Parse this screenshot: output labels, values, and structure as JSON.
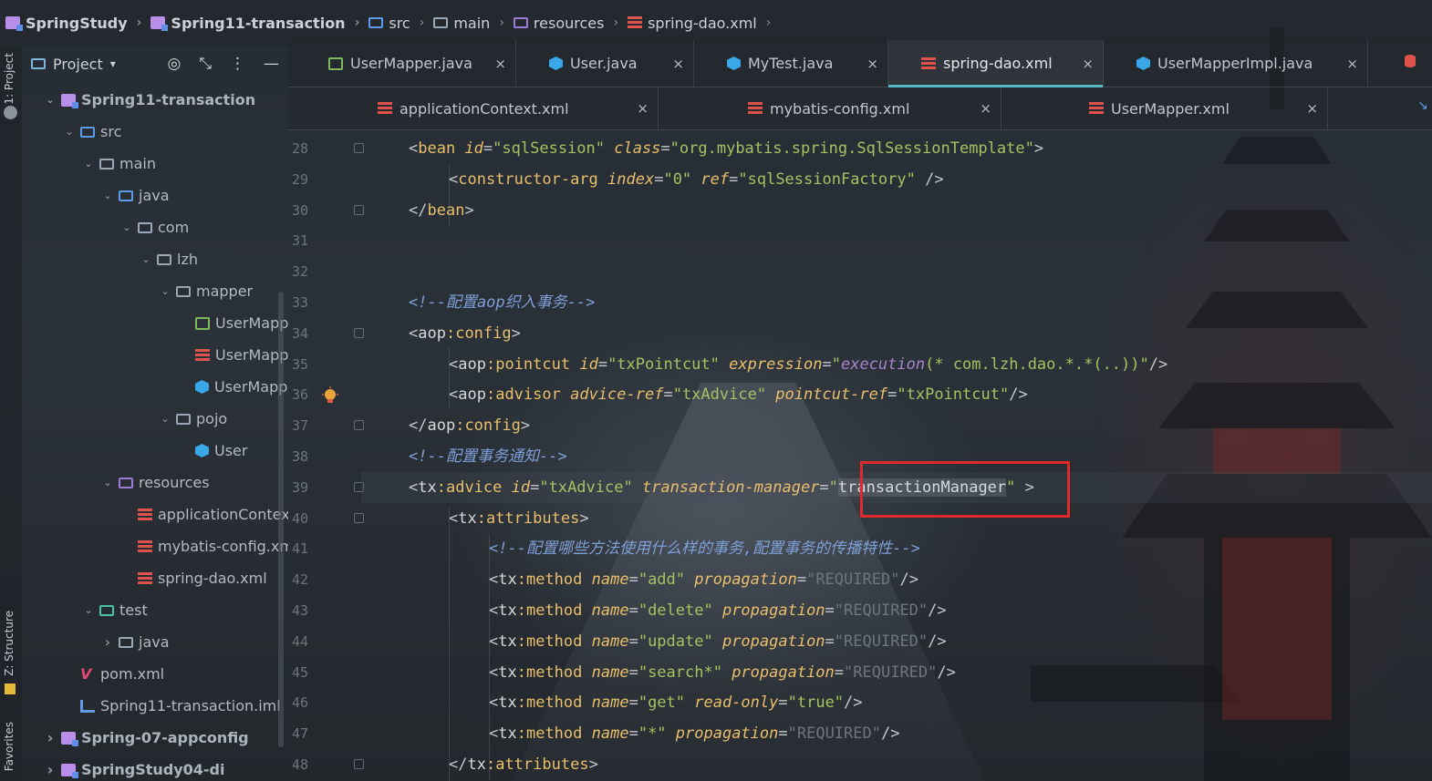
{
  "breadcrumb": [
    {
      "label": "SpringStudy",
      "icon": "module-icon",
      "bold": true
    },
    {
      "label": "Spring11-transaction",
      "icon": "module-icon",
      "bold": true
    },
    {
      "label": "src",
      "icon": "source-folder-icon",
      "bold": false
    },
    {
      "label": "main",
      "icon": "folder-icon",
      "bold": false
    },
    {
      "label": "resources",
      "icon": "resources-folder-icon",
      "bold": false
    },
    {
      "label": "spring-dao.xml",
      "icon": "xml-file-icon",
      "bold": false
    }
  ],
  "side_strip": {
    "project_label": "1: Project",
    "structure_label": "Z: Structure",
    "favorites_label": "Favorites"
  },
  "project_panel": {
    "title": "Project",
    "tree": [
      {
        "label": "Spring11-transaction",
        "depth": 1,
        "arrow": "down",
        "icon": "module",
        "bold": true
      },
      {
        "label": "src",
        "depth": 2,
        "arrow": "down",
        "icon": "src"
      },
      {
        "label": "main",
        "depth": 3,
        "arrow": "down",
        "icon": "folder"
      },
      {
        "label": "java",
        "depth": 4,
        "arrow": "down",
        "icon": "folder-blue"
      },
      {
        "label": "com",
        "depth": 5,
        "arrow": "down",
        "icon": "folder"
      },
      {
        "label": "lzh",
        "depth": 6,
        "arrow": "down",
        "icon": "folder"
      },
      {
        "label": "mapper",
        "depth": 7,
        "arrow": "down",
        "icon": "folder"
      },
      {
        "label": "UserMapp",
        "depth": 8,
        "arrow": "",
        "icon": "iface"
      },
      {
        "label": "UserMapp",
        "depth": 8,
        "arrow": "",
        "icon": "xml"
      },
      {
        "label": "UserMapp",
        "depth": 8,
        "arrow": "",
        "icon": "class"
      },
      {
        "label": "pojo",
        "depth": 7,
        "arrow": "down",
        "icon": "folder"
      },
      {
        "label": "User",
        "depth": 8,
        "arrow": "",
        "icon": "class"
      },
      {
        "label": "resources",
        "depth": 4,
        "arrow": "down",
        "icon": "folder-res"
      },
      {
        "label": "applicationContext",
        "depth": 5,
        "arrow": "",
        "icon": "xml"
      },
      {
        "label": "mybatis-config.xm",
        "depth": 5,
        "arrow": "",
        "icon": "xml"
      },
      {
        "label": "spring-dao.xml",
        "depth": 5,
        "arrow": "",
        "icon": "xml"
      },
      {
        "label": "test",
        "depth": 3,
        "arrow": "down",
        "icon": "folder-test"
      },
      {
        "label": "java",
        "depth": 4,
        "arrow": "right",
        "icon": "folder"
      },
      {
        "label": "pom.xml",
        "depth": 2,
        "arrow": "",
        "icon": "maven"
      },
      {
        "label": "Spring11-transaction.iml",
        "depth": 2,
        "arrow": "",
        "icon": "iml"
      },
      {
        "label": "Spring-07-appconfig",
        "depth": 1,
        "arrow": "right",
        "icon": "module",
        "bold": true
      },
      {
        "label": "SpringStudy04-di",
        "depth": 1,
        "arrow": "right",
        "icon": "module",
        "bold": true
      }
    ]
  },
  "tabs_row1": [
    {
      "label": "UserMapper.java",
      "icon": "iface",
      "active": false
    },
    {
      "label": "User.java",
      "icon": "class",
      "active": false
    },
    {
      "label": "MyTest.java",
      "icon": "class",
      "active": false
    },
    {
      "label": "spring-dao.xml",
      "icon": "xml",
      "active": true
    },
    {
      "label": "UserMapperImpl.java",
      "icon": "class",
      "active": false
    }
  ],
  "tabs_row2": [
    {
      "label": "applicationContext.xml",
      "icon": "xml"
    },
    {
      "label": "mybatis-config.xml",
      "icon": "xml"
    },
    {
      "label": "UserMapper.xml",
      "icon": "xml"
    }
  ],
  "close_glyph": "×",
  "editor": {
    "lines": [
      {
        "n": "28",
        "indent": 0,
        "tokens": [
          [
            "br",
            "<"
          ],
          [
            "tag",
            "bean "
          ],
          [
            "attr",
            "id"
          ],
          [
            "br",
            "="
          ],
          [
            "str",
            "\"sqlSession\" "
          ],
          [
            "attr",
            "class"
          ],
          [
            "br",
            "="
          ],
          [
            "str",
            "\"org.mybatis.spring.SqlSessionTemplate\""
          ],
          [
            "br",
            ">"
          ]
        ]
      },
      {
        "n": "29",
        "indent": 1,
        "tokens": [
          [
            "br",
            "<"
          ],
          [
            "tag",
            "constructor-arg "
          ],
          [
            "attr",
            "index"
          ],
          [
            "br",
            "="
          ],
          [
            "str",
            "\"0\" "
          ],
          [
            "attr",
            "ref"
          ],
          [
            "br",
            "="
          ],
          [
            "str",
            "\"sqlSessionFactory\" "
          ],
          [
            "br",
            "/>"
          ]
        ]
      },
      {
        "n": "30",
        "indent": 0,
        "tokens": [
          [
            "br",
            "</"
          ],
          [
            "tag",
            "bean"
          ],
          [
            "br",
            ">"
          ]
        ]
      },
      {
        "n": "31",
        "indent": 0,
        "tokens": []
      },
      {
        "n": "32",
        "indent": 0,
        "tokens": []
      },
      {
        "n": "33",
        "indent": 0,
        "tokens": [
          [
            "com",
            "<!--配置aop织入事务-->"
          ]
        ]
      },
      {
        "n": "34",
        "indent": 0,
        "tokens": [
          [
            "br",
            "<"
          ],
          [
            "ns",
            "aop"
          ],
          [
            "nsn",
            ":config"
          ],
          [
            "br",
            ">"
          ]
        ]
      },
      {
        "n": "35",
        "indent": 1,
        "tokens": [
          [
            "br",
            "<"
          ],
          [
            "ns",
            "aop"
          ],
          [
            "nsn",
            ":pointcut "
          ],
          [
            "attr",
            "id"
          ],
          [
            "br",
            "="
          ],
          [
            "str",
            "\"txPointcut\" "
          ],
          [
            "attr",
            "expression"
          ],
          [
            "br",
            "="
          ],
          [
            "str",
            "\""
          ],
          [
            "ital",
            "execution"
          ],
          [
            "str",
            "(* com.lzh.dao.*.*(..))\""
          ],
          [
            "br",
            "/>"
          ]
        ]
      },
      {
        "n": "36",
        "indent": 1,
        "tokens": [
          [
            "br",
            "<"
          ],
          [
            "ns",
            "aop"
          ],
          [
            "nsn",
            ":advisor "
          ],
          [
            "attr",
            "advice-ref"
          ],
          [
            "br",
            "="
          ],
          [
            "str",
            "\"txAdvice\" "
          ],
          [
            "attr",
            "pointcut-ref"
          ],
          [
            "br",
            "="
          ],
          [
            "str",
            "\"txPointcut\""
          ],
          [
            "br",
            "/>"
          ]
        ]
      },
      {
        "n": "37",
        "indent": 0,
        "tokens": [
          [
            "br",
            "</"
          ],
          [
            "ns",
            "aop"
          ],
          [
            "nsn",
            ":config"
          ],
          [
            "br",
            ">"
          ]
        ]
      },
      {
        "n": "38",
        "indent": 0,
        "tokens": [
          [
            "com",
            "<!--配置事务通知-->"
          ]
        ]
      },
      {
        "n": "39",
        "indent": 0,
        "tokens": [
          [
            "br",
            "<"
          ],
          [
            "ns",
            "tx"
          ],
          [
            "nsn",
            ":advice "
          ],
          [
            "attr",
            "id"
          ],
          [
            "br",
            "="
          ],
          [
            "str",
            "\"txAdvice\" "
          ],
          [
            "attr",
            "transaction-manager"
          ],
          [
            "br",
            "="
          ],
          [
            "str",
            "\""
          ],
          [
            "plain",
            "transactionManager"
          ],
          [
            "str",
            "\" "
          ],
          [
            "br",
            ">"
          ]
        ]
      },
      {
        "n": "40",
        "indent": 1,
        "tokens": [
          [
            "br",
            "<"
          ],
          [
            "ns",
            "tx"
          ],
          [
            "nsn",
            ":attributes"
          ],
          [
            "br",
            ">"
          ]
        ]
      },
      {
        "n": "41",
        "indent": 2,
        "tokens": [
          [
            "com",
            "<!--配置哪些方法使用什么样的事务,配置事务的传播特性-->"
          ]
        ]
      },
      {
        "n": "42",
        "indent": 2,
        "tokens": [
          [
            "br",
            "<"
          ],
          [
            "ns",
            "tx"
          ],
          [
            "nsn",
            ":method "
          ],
          [
            "attr",
            "name"
          ],
          [
            "br",
            "="
          ],
          [
            "str",
            "\"add\" "
          ],
          [
            "attr",
            "propagation"
          ],
          [
            "br",
            "="
          ],
          [
            "req",
            "\"REQUIRED\""
          ],
          [
            "br",
            "/>"
          ]
        ]
      },
      {
        "n": "43",
        "indent": 2,
        "tokens": [
          [
            "br",
            "<"
          ],
          [
            "ns",
            "tx"
          ],
          [
            "nsn",
            ":method "
          ],
          [
            "attr",
            "name"
          ],
          [
            "br",
            "="
          ],
          [
            "str",
            "\"delete\" "
          ],
          [
            "attr",
            "propagation"
          ],
          [
            "br",
            "="
          ],
          [
            "req",
            "\"REQUIRED\""
          ],
          [
            "br",
            "/>"
          ]
        ]
      },
      {
        "n": "44",
        "indent": 2,
        "tokens": [
          [
            "br",
            "<"
          ],
          [
            "ns",
            "tx"
          ],
          [
            "nsn",
            ":method "
          ],
          [
            "attr",
            "name"
          ],
          [
            "br",
            "="
          ],
          [
            "str",
            "\"update\" "
          ],
          [
            "attr",
            "propagation"
          ],
          [
            "br",
            "="
          ],
          [
            "req",
            "\"REQUIRED\""
          ],
          [
            "br",
            "/>"
          ]
        ]
      },
      {
        "n": "45",
        "indent": 2,
        "tokens": [
          [
            "br",
            "<"
          ],
          [
            "ns",
            "tx"
          ],
          [
            "nsn",
            ":method "
          ],
          [
            "attr",
            "name"
          ],
          [
            "br",
            "="
          ],
          [
            "str",
            "\"search*\" "
          ],
          [
            "attr",
            "propagation"
          ],
          [
            "br",
            "="
          ],
          [
            "req",
            "\"REQUIRED\""
          ],
          [
            "br",
            "/>"
          ]
        ]
      },
      {
        "n": "46",
        "indent": 2,
        "tokens": [
          [
            "br",
            "<"
          ],
          [
            "ns",
            "tx"
          ],
          [
            "nsn",
            ":method "
          ],
          [
            "attr",
            "name"
          ],
          [
            "br",
            "="
          ],
          [
            "str",
            "\"get\" "
          ],
          [
            "attr",
            "read-only"
          ],
          [
            "br",
            "="
          ],
          [
            "str",
            "\"true\""
          ],
          [
            "br",
            "/>"
          ]
        ]
      },
      {
        "n": "47",
        "indent": 2,
        "tokens": [
          [
            "br",
            "<"
          ],
          [
            "ns",
            "tx"
          ],
          [
            "nsn",
            ":method "
          ],
          [
            "attr",
            "name"
          ],
          [
            "br",
            "="
          ],
          [
            "str",
            "\"*\" "
          ],
          [
            "attr",
            "propagation"
          ],
          [
            "br",
            "="
          ],
          [
            "req",
            "\"REQUIRED\""
          ],
          [
            "br",
            "/>"
          ]
        ]
      },
      {
        "n": "48",
        "indent": 1,
        "tokens": [
          [
            "br",
            "</"
          ],
          [
            "ns",
            "tx"
          ],
          [
            "nsn",
            ":attributes"
          ],
          [
            "br",
            ">"
          ]
        ]
      }
    ],
    "current_line": "39",
    "highlighted_value": "transactionManager"
  },
  "colors": {
    "tag": "#e8bf6a",
    "string": "#a5c261",
    "comment": "#7ea0d8",
    "accent": "#56b6c2",
    "highlight_box": "#e02a2a"
  }
}
